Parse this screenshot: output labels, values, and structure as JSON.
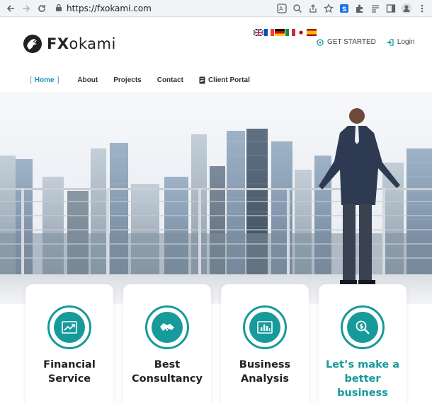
{
  "browser": {
    "url": "https://fxokami.com"
  },
  "header": {
    "logo_fx": "FX",
    "logo_rest": "okami",
    "get_started": "GET STARTED",
    "login": "Login",
    "flags": [
      "uk",
      "fr",
      "de",
      "it",
      "jp",
      "es"
    ]
  },
  "nav": {
    "items": [
      {
        "label": "Home",
        "active": true
      },
      {
        "label": "About"
      },
      {
        "label": "Projects"
      },
      {
        "label": "Contact"
      },
      {
        "label": "Client Portal"
      }
    ]
  },
  "cards": [
    {
      "line1": "Financial",
      "line2": "Service",
      "line3": "",
      "icon": "chart-up-icon"
    },
    {
      "line1": "Best",
      "line2": "Consultancy",
      "line3": "",
      "icon": "handshake-icon"
    },
    {
      "line1": "Business",
      "line2": "Analysis",
      "line3": "",
      "icon": "bar-chart-icon"
    },
    {
      "line1": "Let’s make a",
      "line2": "better",
      "line3": "business",
      "icon": "dollar-search-icon"
    }
  ],
  "colors": {
    "teal": "#179a9c",
    "nav_active": "#1a8fbf"
  }
}
